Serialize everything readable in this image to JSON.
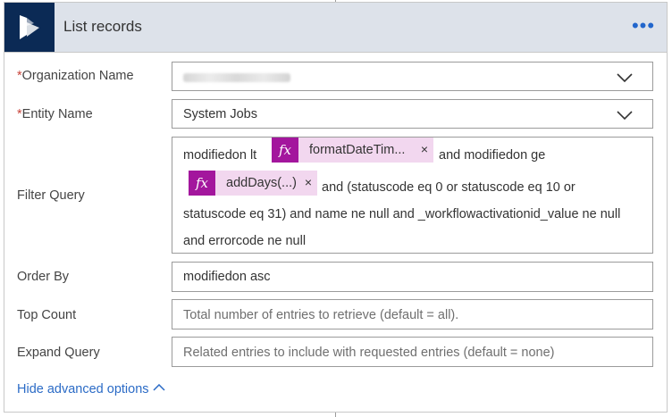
{
  "header": {
    "title": "List records",
    "more_label": "•••"
  },
  "fields": {
    "organization": {
      "label": "Organization Name",
      "required_mark": "*"
    },
    "entity": {
      "label": "Entity Name",
      "required_mark": "*",
      "value": "System Jobs"
    },
    "filter": {
      "label": "Filter Query",
      "line1_text": "modifiedon lt",
      "token1_label": "formatDateTim...",
      "line1_after": "and modifiedon ge",
      "token2_label": "addDays(...)",
      "line2_after": "and (statuscode eq 0 or  statuscode eq 10 or",
      "line3": "statuscode eq 31) and  name ne null and  _workflowactivationid_value ne null",
      "line4": "and  errorcode ne null",
      "token_close": "×",
      "fx_label": "fx"
    },
    "order_by": {
      "label": "Order By",
      "value": "modifiedon asc"
    },
    "top_count": {
      "label": "Top Count",
      "placeholder": "Total number of entries to retrieve (default = all)."
    },
    "expand_query": {
      "label": "Expand Query",
      "placeholder": "Related entries to include with requested entries (default = none)"
    }
  },
  "footer": {
    "advanced_link": "Hide advanced options"
  },
  "colors": {
    "header_bg": "#dde2ea",
    "logo_bg": "#0b2a55",
    "accent_link": "#2b6bc6",
    "token_bg": "#f2d7ef",
    "token_icon_bg": "#a3169d",
    "required": "#c8443a"
  }
}
